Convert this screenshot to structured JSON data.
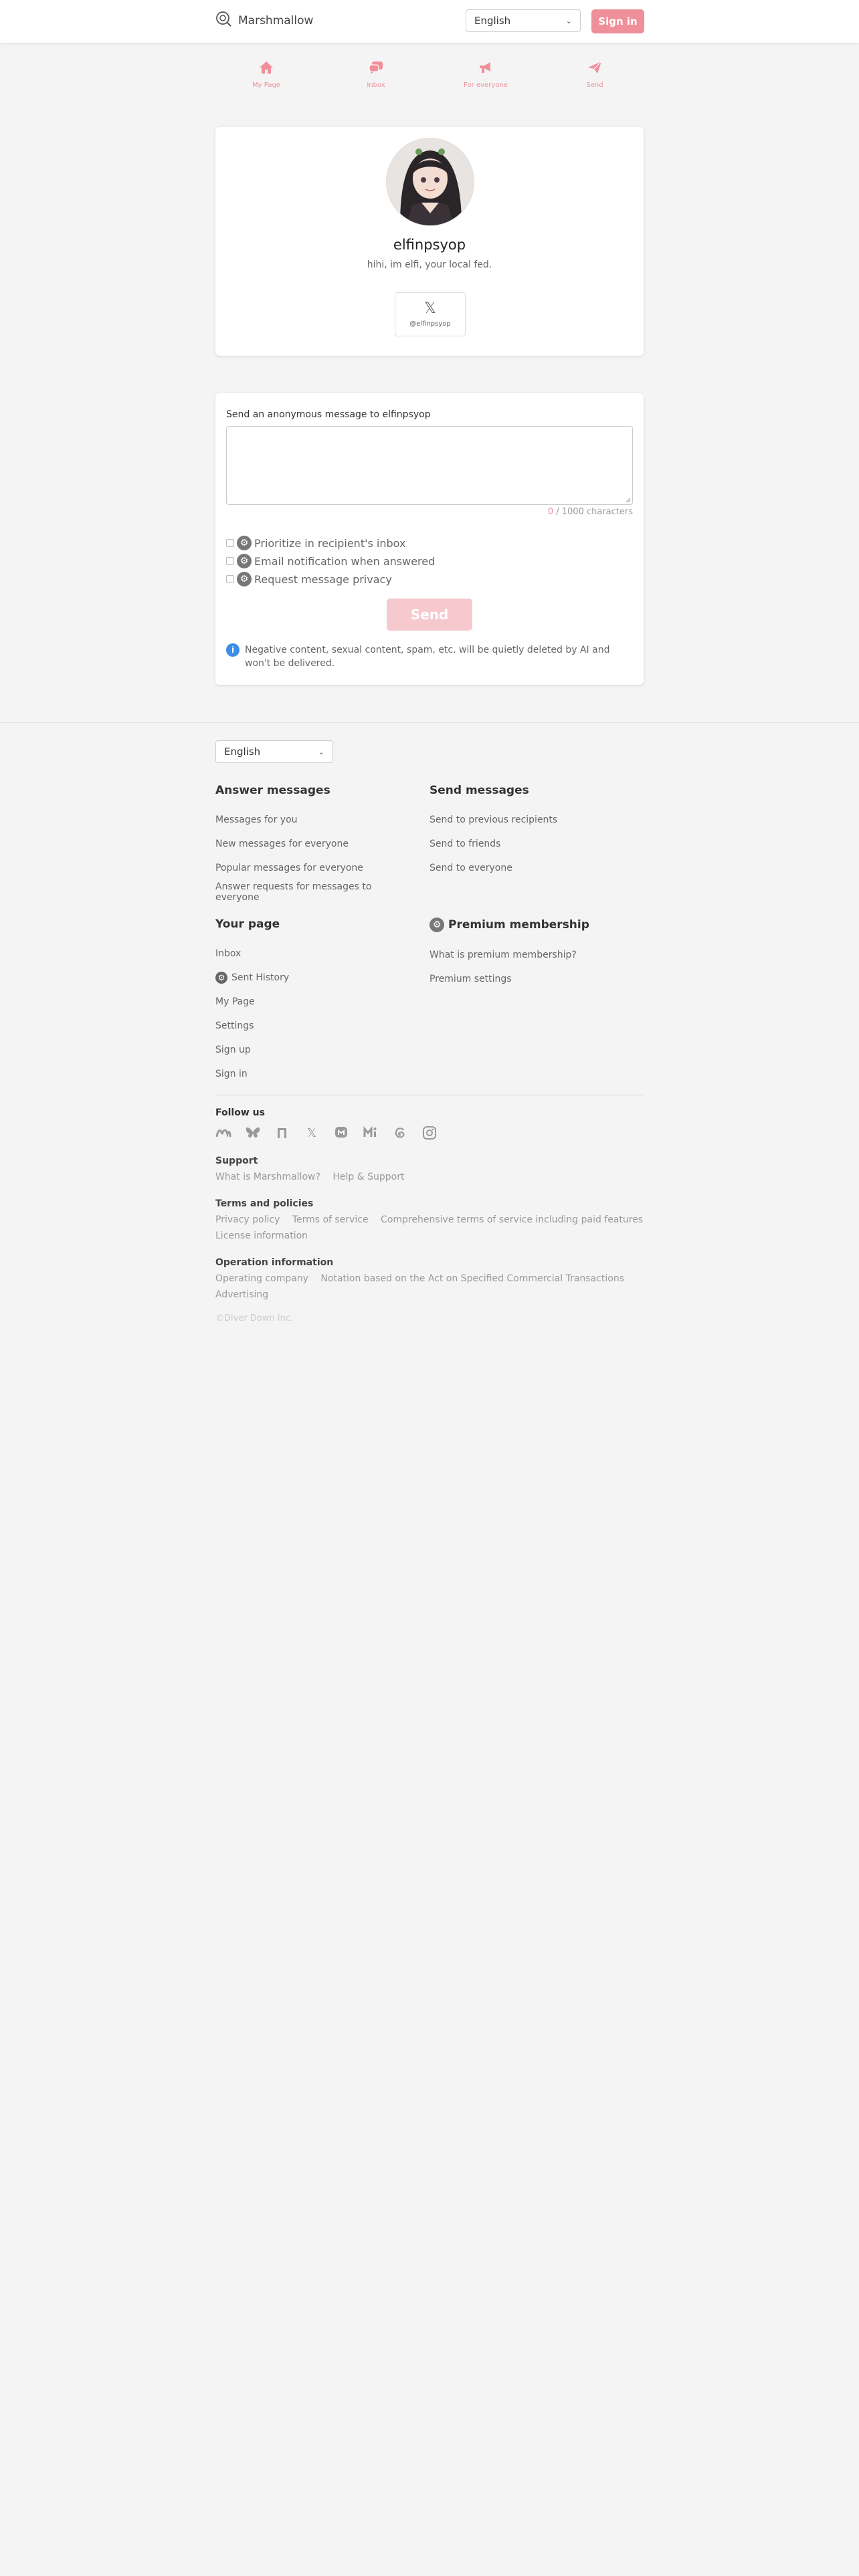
{
  "header": {
    "brand": "Marshmallow",
    "language": "English",
    "sign_in": "Sign in"
  },
  "nav": [
    {
      "label": "My Page",
      "icon": "home-icon"
    },
    {
      "label": "Inbox",
      "icon": "inbox-icon"
    },
    {
      "label": "For everyone",
      "icon": "megaphone-icon"
    },
    {
      "label": "Send",
      "icon": "send-icon"
    }
  ],
  "profile": {
    "name": "elfinpsyop",
    "bio": "hihi, im elfi, your local fed.",
    "x_handle": "@elfinpsyop"
  },
  "message": {
    "label": "Send an anonymous message to elfinpsyop",
    "count_current": "0",
    "count_total": " / 1000 characters",
    "options": [
      "Prioritize in recipient's inbox",
      "Email notification when answered",
      "Request message privacy"
    ],
    "send": "Send",
    "notice": "Negative content, sexual content, spam, etc. will be quietly deleted by AI and won't be delivered."
  },
  "footer": {
    "language": "English",
    "answer": {
      "title": "Answer messages",
      "links": [
        "Messages for you",
        "New messages for everyone",
        "Popular messages for everyone",
        "Answer requests for messages to everyone"
      ]
    },
    "send": {
      "title": "Send messages",
      "links": [
        "Send to previous recipients",
        "Send to friends",
        "Send to everyone"
      ]
    },
    "your_page": {
      "title": "Your page",
      "links": [
        "Inbox",
        "Sent History",
        "My Page",
        "Settings",
        "Sign up",
        "Sign in"
      ]
    },
    "premium": {
      "title": "Premium membership",
      "links": [
        "What is premium membership?",
        "Premium settings"
      ]
    },
    "follow_us": "Follow us",
    "support": {
      "title": "Support",
      "links": [
        "What is Marshmallow?",
        "Help & Support"
      ]
    },
    "terms": {
      "title": "Terms and policies",
      "links": [
        "Privacy policy",
        "Terms of service",
        "Comprehensive terms of service including paid features",
        "License information"
      ]
    },
    "operation": {
      "title": "Operation information",
      "links": [
        "Operating company",
        "Notation based on the Act on Specified Commercial Transactions",
        "Advertising"
      ]
    },
    "copyright": "©Diver Down Inc."
  },
  "colors": {
    "accent": "#ef8f9a",
    "accent_light": "#f6c9ce",
    "info": "#3b8ee6",
    "background": "#f4f4f4"
  }
}
